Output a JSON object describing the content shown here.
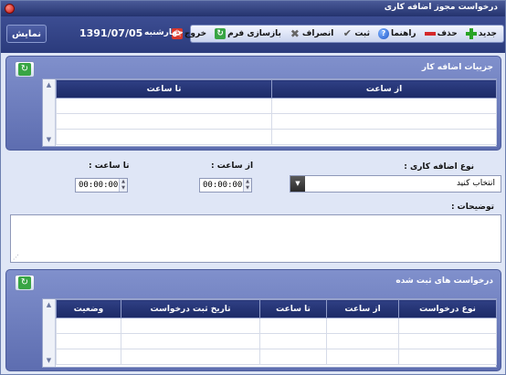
{
  "window": {
    "title": "درخواست مجوز اضافه کاری"
  },
  "toolbar": {
    "buttons": [
      {
        "label": "جدید",
        "icon": "plus-icon"
      },
      {
        "label": "حذف",
        "icon": "minus-icon"
      },
      {
        "label": "راهنما",
        "icon": "help-icon"
      },
      {
        "label": "ثبت",
        "icon": "check-icon"
      },
      {
        "label": "انصراف",
        "icon": "cancel-icon"
      },
      {
        "label": "بازسازی فرم",
        "icon": "refresh-icon"
      },
      {
        "label": "خروج",
        "icon": "exit-icon"
      }
    ],
    "day": "چهارشنبه",
    "date": "1391/07/05",
    "show_label": "نمایش"
  },
  "details": {
    "title": "جزییات اضافه کار",
    "columns": [
      "از ساعت",
      "تا ساعت"
    ]
  },
  "form": {
    "type_label": "نوع اضافه کاری :",
    "type_value": "انتخاب کنید",
    "from_label": "از ساعت :",
    "to_label": "تا ساعت :",
    "from_value": "00:00:00",
    "to_value": "00:00:00",
    "notes_label": "توضیحات :"
  },
  "requests": {
    "title": "درخواست های ثبت شده",
    "columns": [
      "نوع درخواست",
      "از ساعت",
      "تا ساعت",
      "تاریخ ثبت درخواست",
      "وضعیت"
    ]
  },
  "colors": {
    "header_dark": "#1c2a66",
    "panel": "#6d7dbd",
    "accent_green": "#28a325",
    "accent_red": "#d4282a"
  }
}
